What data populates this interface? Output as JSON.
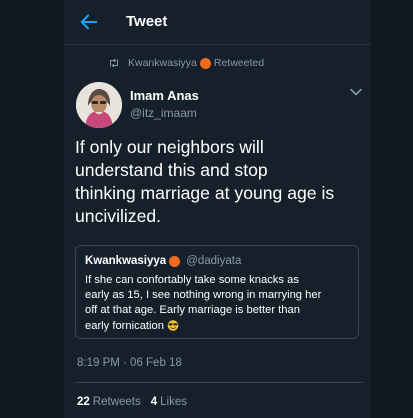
{
  "header": {
    "back_icon": "arrow-left-icon",
    "title": "Tweet"
  },
  "retweet_context": {
    "icon": "retweet-icon",
    "user": "Kwankwasiyya",
    "label": "Retweeted"
  },
  "tweet": {
    "author_name": "Imam Anas",
    "author_handle": "@itz_imaam",
    "menu_icon": "chevron-down-icon",
    "text": "If only our neighbors will\nunderstand this and stop\nthinking marriage at young age is\nuncivilized.",
    "timestamp": "8:19 PM · 06 Feb 18"
  },
  "quoted_tweet": {
    "author_name": "Kwankwasiyya",
    "author_handle": "@dadiyata",
    "text": "If she can confortably take some knacks as\nearly as 15, I see nothing wrong in marrying her\noff at that age. Early marriage is better than\nearly fornication",
    "emoji": "smiling-face-with-sunglasses-icon"
  },
  "stats": {
    "retweets_count": "22",
    "retweets_label": "Retweets",
    "likes_count": "4",
    "likes_label": "Likes"
  },
  "colors": {
    "background": "#15202b",
    "outer_background": "#10171e",
    "accent": "#1da1f2",
    "secondary_text": "#8899a6",
    "border": "#38444d",
    "badge": "#f26b1d"
  }
}
